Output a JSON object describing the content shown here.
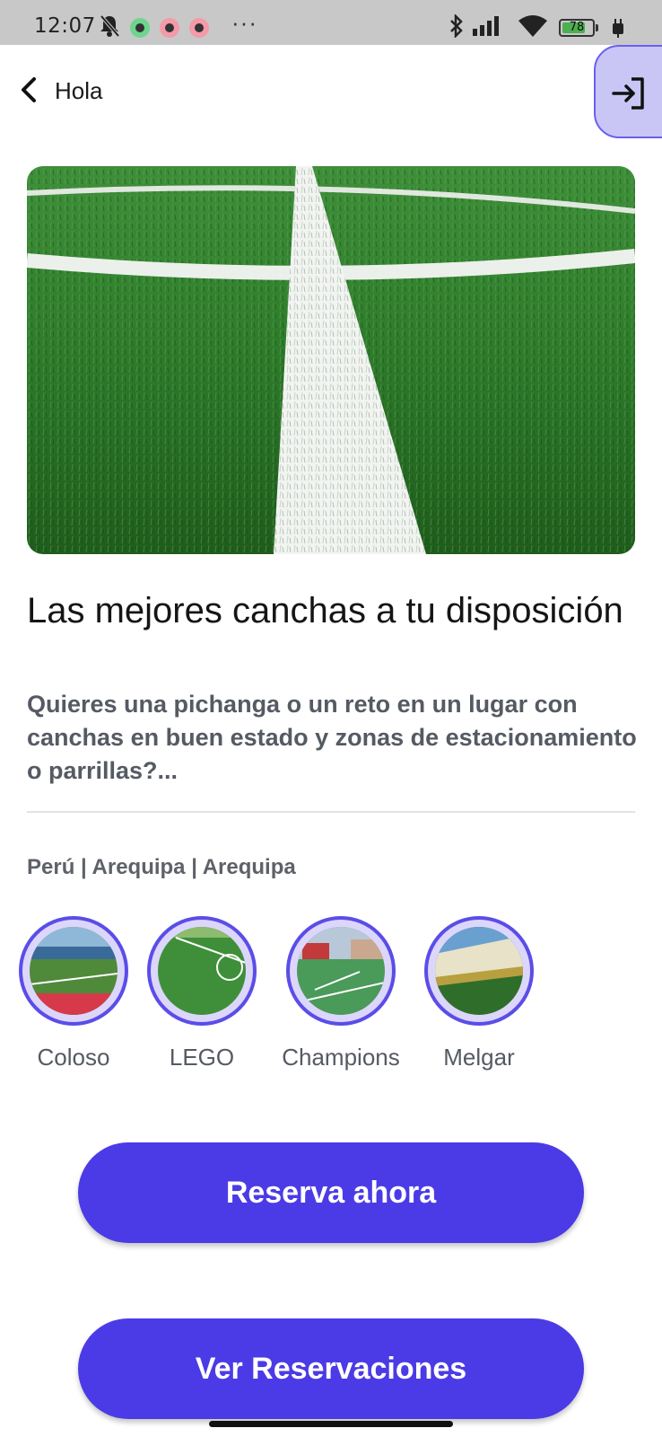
{
  "status_bar": {
    "time": "12:07",
    "battery": "78",
    "battery_level": 0.78,
    "icons": [
      "bell-off-icon",
      "whatsapp-icon",
      "gmail-icon",
      "gmail-icon",
      "more-dots-icon",
      "bluetooth-icon",
      "signal-icon",
      "wifi-icon",
      "battery-icon",
      "charging-icon"
    ],
    "dots": "···"
  },
  "app_bar": {
    "title": "Hola",
    "back_icon": "chevron-left-icon",
    "logout_icon": "login-arrow-icon",
    "logout_bg": "#c9c6f6",
    "logout_border": "#6a5ff0"
  },
  "hero": {
    "image": "soccer-field-grass-photo"
  },
  "content": {
    "headline": "Las mejores canchas  a tu disposición",
    "description": "Quieres una pichanga o un reto en un lugar con canchas en buen estado y zonas de estacionamiento o parrillas?...",
    "location": "Perú | Arequipa | Arequipa"
  },
  "venues": [
    {
      "label": "Coloso"
    },
    {
      "label": "LEGO"
    },
    {
      "label": "Champions"
    },
    {
      "label": "Melgar"
    }
  ],
  "buttons": {
    "reserve": "Reserva ahora",
    "view": "Ver Reservaciones"
  },
  "colors": {
    "accent": "#4b3be6",
    "ring": "#5b4de8",
    "text_secondary": "#555a63"
  }
}
